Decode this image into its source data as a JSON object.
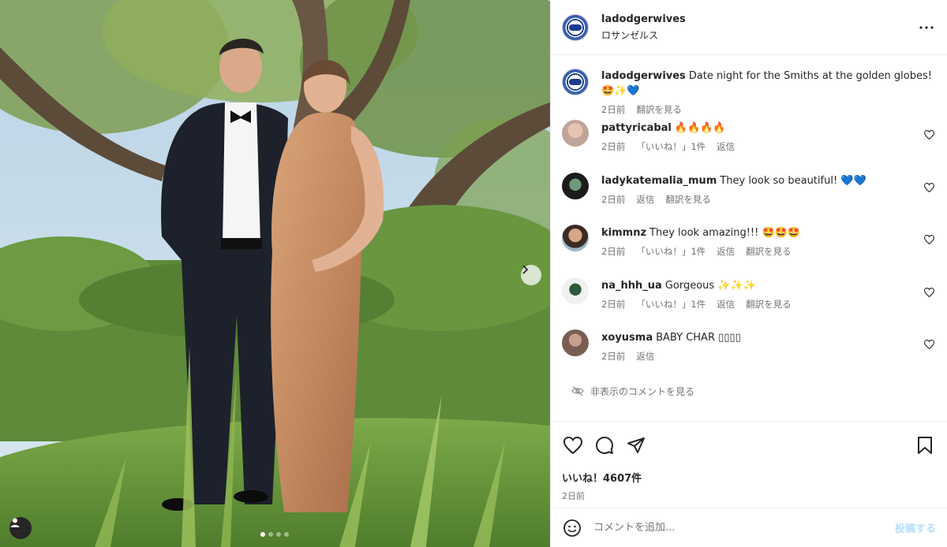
{
  "post": {
    "username": "ladodgerwives",
    "location": "ロサンゼルス",
    "more_icon": "more-horizontal-icon"
  },
  "caption": {
    "username": "ladodgerwives",
    "text": "Date night for the Smiths at the golden globes!",
    "emoji": "🤩✨💙",
    "time": "2日前",
    "translate": "翻訳を見る"
  },
  "comments": [
    {
      "username": "pattyricabal",
      "text": "🔥🔥🔥🔥",
      "time": "2日前",
      "actions": [
        "「いいね！」1件",
        "返信"
      ]
    },
    {
      "username": "ladykatemalia_mum",
      "text": "They look so beautiful! 💙💙",
      "time": "2日前",
      "actions": [
        "返信",
        "翻訳を見る"
      ]
    },
    {
      "username": "kimmnz",
      "text": "They look amazing!!! 🤩🤩🤩",
      "time": "2日前",
      "actions": [
        "「いいね！」1件",
        "返信",
        "翻訳を見る"
      ]
    },
    {
      "username": "na_hhh_ua",
      "text": "Gorgeous ✨✨✨",
      "time": "2日前",
      "actions": [
        "「いいね！」1件",
        "返信",
        "翻訳を見る"
      ]
    },
    {
      "username": "xoyusma",
      "text": "BABY CHAR ▯▯▯▯",
      "time": "2日前",
      "actions": [
        "返信"
      ]
    }
  ],
  "hidden_comments": "非表示のコメントを見る",
  "likes": "いいね！4607件",
  "post_date": "2日前",
  "add_comment": {
    "placeholder": "コメントを追加...",
    "post_label": "投稿する"
  },
  "carousel": {
    "current": 1,
    "total": 4
  },
  "colors": {
    "text": "#262626",
    "secondary": "#737373",
    "border": "#efefef",
    "post_button": "#b2dffc"
  }
}
